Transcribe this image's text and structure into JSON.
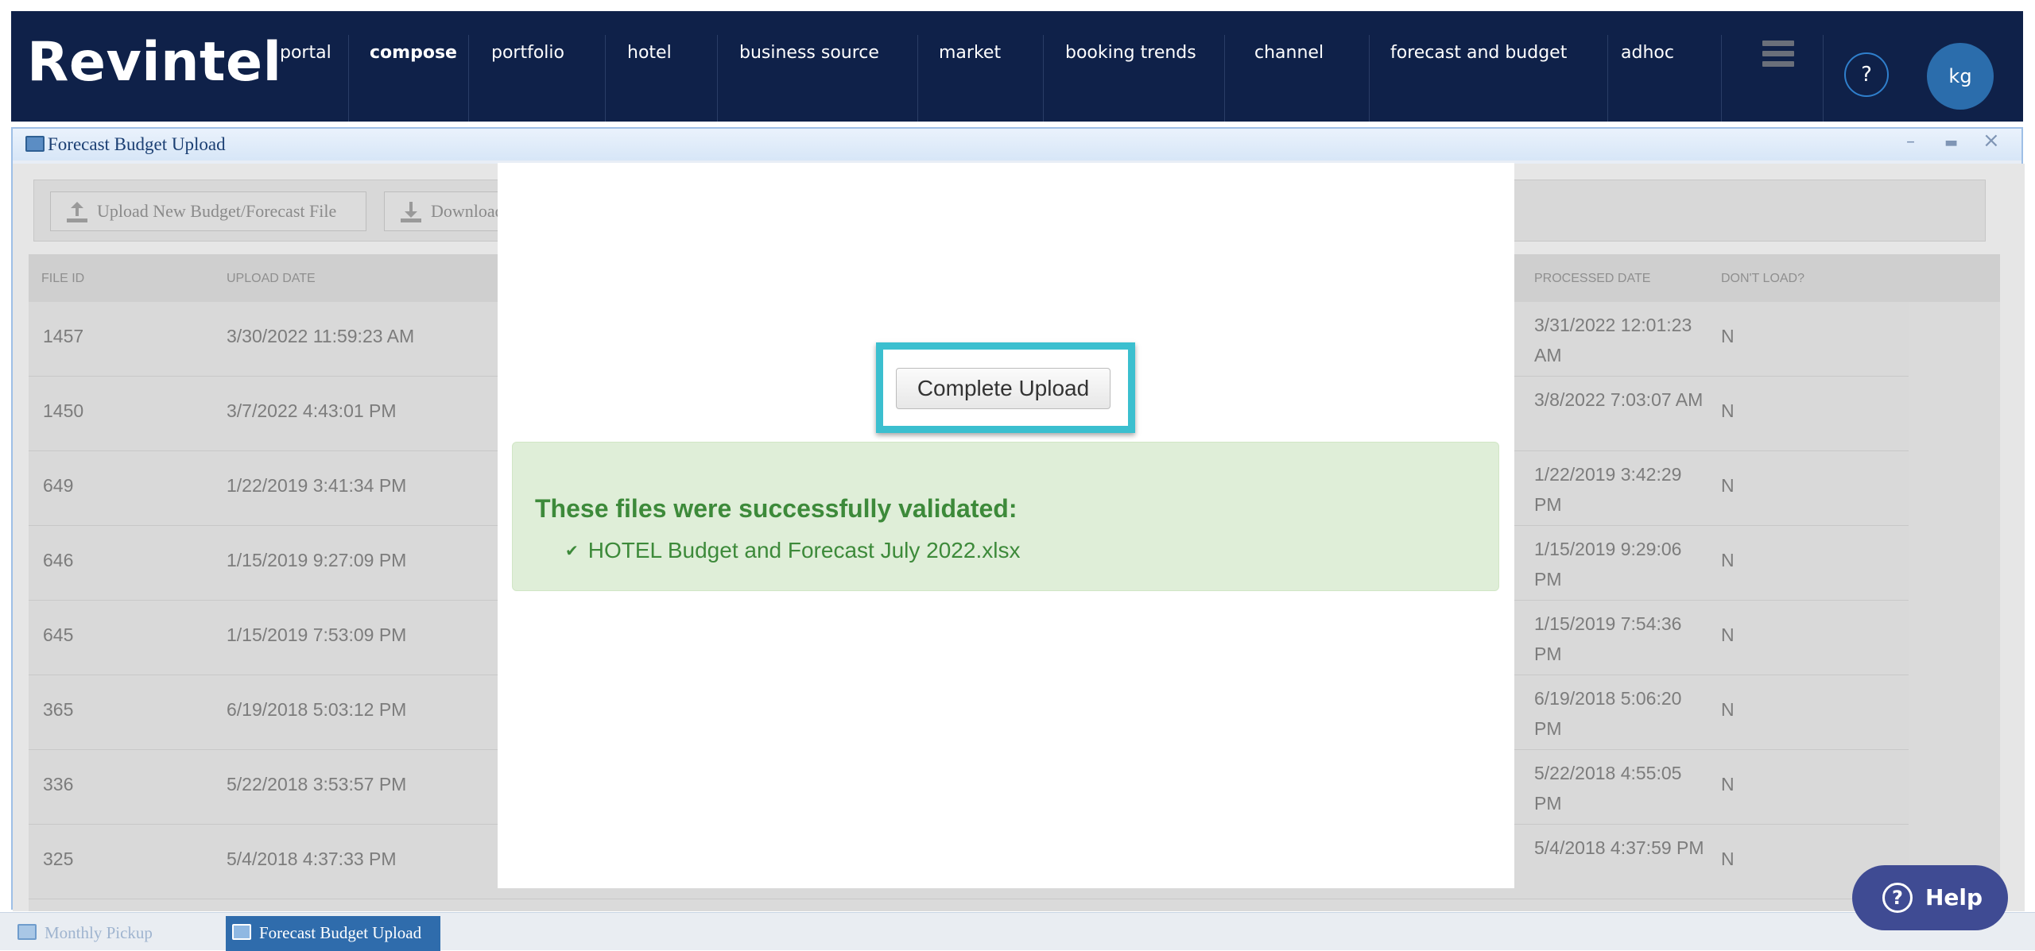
{
  "app": {
    "brand": "Revintel",
    "nav": [
      {
        "label": "portal",
        "active": false
      },
      {
        "label": "compose",
        "active": true
      },
      {
        "label": "portfolio",
        "active": false
      },
      {
        "label": "hotel",
        "active": false
      },
      {
        "label": "business source",
        "active": false
      },
      {
        "label": "market",
        "active": false
      },
      {
        "label": "booking trends",
        "active": false
      },
      {
        "label": "channel",
        "active": false
      },
      {
        "label": "forecast and budget",
        "active": false
      },
      {
        "label": "adhoc",
        "active": false
      }
    ],
    "menu_icon": "hamburger-icon",
    "help_icon_label": "?",
    "user_initials": "kg"
  },
  "window": {
    "title": "Forecast Budget Upload",
    "controls": {
      "minimize": "–",
      "maximize": "▬",
      "close": "×"
    },
    "toolbar": {
      "upload_label": "Upload New Budget/Forecast File",
      "download_label": "Download"
    },
    "table": {
      "headers": {
        "file_id": "FILE ID",
        "upload_date": "UPLOAD DATE",
        "processed_date": "PROCESSED DATE",
        "dont_load": "DON'T LOAD?"
      },
      "rows": [
        {
          "file_id": "1457",
          "upload_date": "3/30/2022 11:59:23 AM",
          "processed_date": "3/31/2022 12:01:23 AM",
          "dont_load": "N"
        },
        {
          "file_id": "1450",
          "upload_date": "3/7/2022 4:43:01 PM",
          "processed_date": "3/8/2022 7:03:07 AM",
          "dont_load": "N"
        },
        {
          "file_id": "649",
          "upload_date": "1/22/2019 3:41:34 PM",
          "processed_date": "1/22/2019 3:42:29 PM",
          "dont_load": "N"
        },
        {
          "file_id": "646",
          "upload_date": "1/15/2019 9:27:09 PM",
          "processed_date": "1/15/2019 9:29:06 PM",
          "dont_load": "N"
        },
        {
          "file_id": "645",
          "upload_date": "1/15/2019 7:53:09 PM",
          "processed_date": "1/15/2019 7:54:36 PM",
          "dont_load": "N"
        },
        {
          "file_id": "365",
          "upload_date": "6/19/2018 5:03:12 PM",
          "processed_date": "6/19/2018 5:06:20 PM",
          "dont_load": "N"
        },
        {
          "file_id": "336",
          "upload_date": "5/22/2018 3:53:57 PM",
          "processed_date": "5/22/2018 4:55:05 PM",
          "dont_load": "N"
        },
        {
          "file_id": "325",
          "upload_date": "5/4/2018 4:37:33 PM",
          "processed_date": "5/4/2018 4:37:59 PM",
          "dont_load": "N"
        }
      ]
    }
  },
  "modal": {
    "complete_upload_label": "Complete Upload",
    "alert_title": "These files were successfully validated:",
    "alert_check": "✔",
    "validated_files": [
      "HOTEL Budget and Forecast July 2022.xlsx"
    ],
    "highlight_color": "#3bbfcf",
    "success_color": "#3d8a3a"
  },
  "taskbar": {
    "tasks": [
      {
        "label": "Monthly Pickup",
        "active": false
      },
      {
        "label": "Forecast Budget Upload",
        "active": true
      }
    ]
  },
  "help_widget": {
    "label": "Help",
    "icon_label": "?"
  }
}
